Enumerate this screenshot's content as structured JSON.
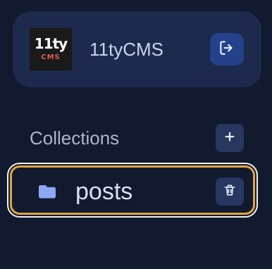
{
  "header": {
    "logo": {
      "main_text": "11ty",
      "sub_text": "CMS"
    },
    "title": "11tyCMS",
    "logout_icon": "logout-icon"
  },
  "collections": {
    "title": "Collections",
    "add_icon": "plus-icon",
    "items": [
      {
        "label": "posts",
        "icon": "folder-icon",
        "delete_icon": "trash-icon",
        "selected": true
      }
    ]
  },
  "colors": {
    "background": "#111a2e",
    "header_card": "#1d2a4d",
    "accent_button": "#24428a",
    "secondary_button": "#283760",
    "selected_outline": "#e2a540",
    "selected_outer_outline": "#f2f2f2",
    "folder_icon": "#8fa7f3",
    "text_primary": "#d9e1f5",
    "text_muted": "#aeb7c9",
    "logo_background": "#1a1a1a",
    "logo_sub_text": "#e05d55"
  }
}
